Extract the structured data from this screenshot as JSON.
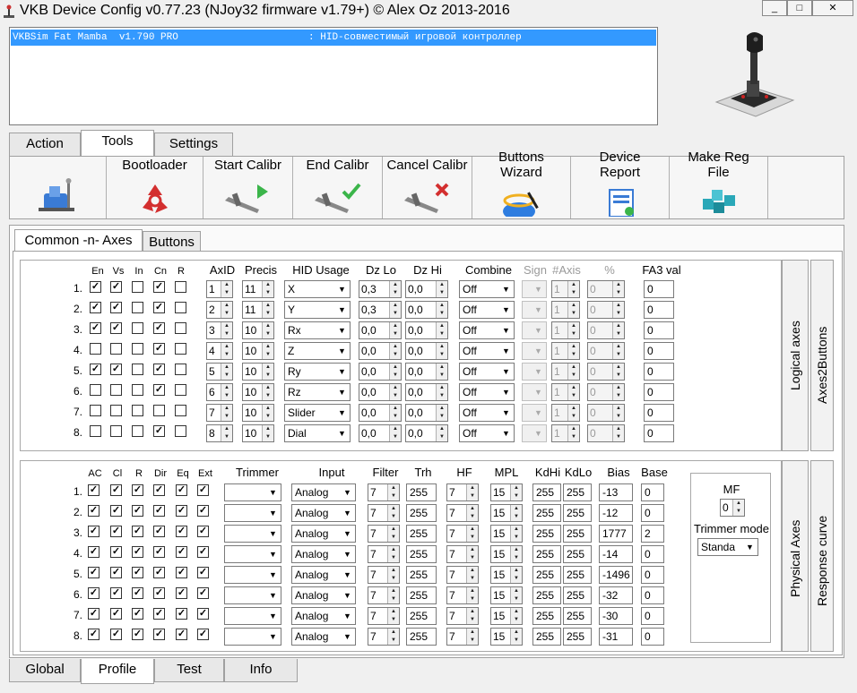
{
  "window": {
    "title": "VKB Device Config v0.77.23 (NJoy32 firmware v1.79+) © Alex Oz 2013-2016",
    "minimize_glyph": "_",
    "maximize_glyph": "□",
    "close_glyph": "✕"
  },
  "device_list": {
    "row": "VKBSim Fat Mamba  v1.790 PRO                      : HID-совместимый игровой контроллер"
  },
  "main_tabs": [
    "Action",
    "Tools",
    "Settings"
  ],
  "toolbar": {
    "buttons": [
      "",
      "Bootloader",
      "Start Calibr",
      "End Calibr",
      "Cancel Calibr",
      "Buttons\nWizard",
      "Device\nReport",
      "Make Reg\nFile"
    ]
  },
  "sub_tabs": [
    "Common -n- Axes",
    "Buttons"
  ],
  "logical": {
    "side_tabs": [
      "Logical axes",
      "Axes2Buttons"
    ],
    "headers": {
      "en": "En",
      "vs": "Vs",
      "in": "In",
      "cn": "Cn",
      "r": "R",
      "axid": "AxID",
      "precis": "Precis",
      "hid_usage": "HID Usage",
      "dz_lo": "Dz Lo",
      "dz_hi": "Dz Hi",
      "combine": "Combine",
      "sign": "Sign",
      "axis": "#Axis",
      "pct": "%",
      "fa3": "FA3 val"
    },
    "rows": [
      {
        "n": "1.",
        "en": true,
        "vs": true,
        "in": false,
        "cn": true,
        "r": false,
        "axid": "1",
        "precis": "11",
        "usage": "X",
        "dzlo": "0,3",
        "dzhi": "0,0",
        "combine": "Off",
        "sign": "",
        "axis": "1",
        "pct": "0",
        "fa3": "0"
      },
      {
        "n": "2.",
        "en": true,
        "vs": true,
        "in": false,
        "cn": true,
        "r": false,
        "axid": "2",
        "precis": "11",
        "usage": "Y",
        "dzlo": "0,3",
        "dzhi": "0,0",
        "combine": "Off",
        "sign": "",
        "axis": "1",
        "pct": "0",
        "fa3": "0"
      },
      {
        "n": "3.",
        "en": true,
        "vs": true,
        "in": false,
        "cn": true,
        "r": false,
        "axid": "3",
        "precis": "10",
        "usage": "Rx",
        "dzlo": "0,0",
        "dzhi": "0,0",
        "combine": "Off",
        "sign": "",
        "axis": "1",
        "pct": "0",
        "fa3": "0"
      },
      {
        "n": "4.",
        "en": false,
        "vs": false,
        "in": false,
        "cn": true,
        "r": false,
        "axid": "4",
        "precis": "10",
        "usage": "Z",
        "dzlo": "0,0",
        "dzhi": "0,0",
        "combine": "Off",
        "sign": "",
        "axis": "1",
        "pct": "0",
        "fa3": "0"
      },
      {
        "n": "5.",
        "en": true,
        "vs": true,
        "in": false,
        "cn": true,
        "r": false,
        "axid": "5",
        "precis": "10",
        "usage": "Ry",
        "dzlo": "0,0",
        "dzhi": "0,0",
        "combine": "Off",
        "sign": "",
        "axis": "1",
        "pct": "0",
        "fa3": "0"
      },
      {
        "n": "6.",
        "en": false,
        "vs": false,
        "in": false,
        "cn": true,
        "r": false,
        "axid": "6",
        "precis": "10",
        "usage": "Rz",
        "dzlo": "0,0",
        "dzhi": "0,0",
        "combine": "Off",
        "sign": "",
        "axis": "1",
        "pct": "0",
        "fa3": "0"
      },
      {
        "n": "7.",
        "en": false,
        "vs": false,
        "in": false,
        "cn": false,
        "r": false,
        "axid": "7",
        "precis": "10",
        "usage": "Slider",
        "dzlo": "0,0",
        "dzhi": "0,0",
        "combine": "Off",
        "sign": "",
        "axis": "1",
        "pct": "0",
        "fa3": "0"
      },
      {
        "n": "8.",
        "en": false,
        "vs": false,
        "in": false,
        "cn": true,
        "r": false,
        "axid": "8",
        "precis": "10",
        "usage": "Dial",
        "dzlo": "0,0",
        "dzhi": "0,0",
        "combine": "Off",
        "sign": "",
        "axis": "1",
        "pct": "0",
        "fa3": "0"
      }
    ]
  },
  "physical": {
    "side_tabs": [
      "Physical Axes",
      "Response curve"
    ],
    "headers": {
      "ac": "AC",
      "cl": "Cl",
      "r": "R",
      "dir": "Dir",
      "eq": "Eq",
      "ext": "Ext",
      "trimmer": "Trimmer",
      "input": "Input",
      "filter": "Filter",
      "trh": "Trh",
      "hf": "HF",
      "mpl": "MPL",
      "kdhi": "KdHi",
      "kdlo": "KdLo",
      "bias": "Bias",
      "base": "Base"
    },
    "rows": [
      {
        "n": "1.",
        "input": "Analog",
        "filter": "7",
        "trh": "255",
        "hf": "7",
        "mpl": "15",
        "kdhi": "255",
        "kdlo": "255",
        "bias": "-13",
        "base": "0"
      },
      {
        "n": "2.",
        "input": "Analog",
        "filter": "7",
        "trh": "255",
        "hf": "7",
        "mpl": "15",
        "kdhi": "255",
        "kdlo": "255",
        "bias": "-12",
        "base": "0"
      },
      {
        "n": "3.",
        "input": "Analog",
        "filter": "7",
        "trh": "255",
        "hf": "7",
        "mpl": "15",
        "kdhi": "255",
        "kdlo": "255",
        "bias": "1777",
        "base": "2"
      },
      {
        "n": "4.",
        "input": "Analog",
        "filter": "7",
        "trh": "255",
        "hf": "7",
        "mpl": "15",
        "kdhi": "255",
        "kdlo": "255",
        "bias": "-14",
        "base": "0"
      },
      {
        "n": "5.",
        "input": "Analog",
        "filter": "7",
        "trh": "255",
        "hf": "7",
        "mpl": "15",
        "kdhi": "255",
        "kdlo": "255",
        "bias": "-1496",
        "base": "0"
      },
      {
        "n": "6.",
        "input": "Analog",
        "filter": "7",
        "trh": "255",
        "hf": "7",
        "mpl": "15",
        "kdhi": "255",
        "kdlo": "255",
        "bias": "-32",
        "base": "0"
      },
      {
        "n": "7.",
        "input": "Analog",
        "filter": "7",
        "trh": "255",
        "hf": "7",
        "mpl": "15",
        "kdhi": "255",
        "kdlo": "255",
        "bias": "-30",
        "base": "0"
      },
      {
        "n": "8.",
        "input": "Analog",
        "filter": "7",
        "trh": "255",
        "hf": "7",
        "mpl": "15",
        "kdhi": "255",
        "kdlo": "255",
        "bias": "-31",
        "base": "0"
      }
    ],
    "mf_label": "MF",
    "mf_value": "0",
    "trimmer_mode_label": "Trimmer mode",
    "trimmer_mode_value": "Standa"
  },
  "bottom_tabs": [
    "Global",
    "Profile",
    "Test",
    "Info"
  ],
  "colors": {
    "selection": "#3399ff",
    "check": "#000000"
  }
}
